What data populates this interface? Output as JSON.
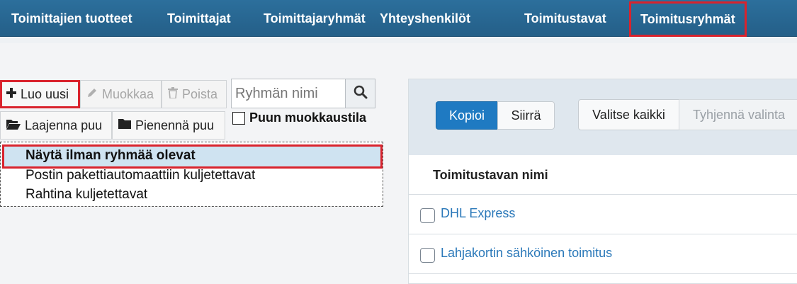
{
  "nav": {
    "tabs": [
      {
        "label": "Toimittajien tuotteet"
      },
      {
        "label": "Toimittajat"
      },
      {
        "label": "Toimittajaryhmät"
      },
      {
        "label": "Yhteyshenkilöt"
      },
      {
        "label": "Toimitustavat"
      },
      {
        "label": "Toimitusryhmät",
        "active": true
      }
    ]
  },
  "toolbar": {
    "create_label": "Luo uusi",
    "edit_label": "Muokkaa",
    "delete_label": "Poista",
    "search_placeholder": "Ryhmän nimi",
    "expand_label": "Laajenna puu",
    "collapse_label": "Pienennä puu",
    "edit_mode_label": "Puun muokkaustila"
  },
  "tree": {
    "items": [
      {
        "label": "Näytä ilman ryhmää olevat",
        "selected": true
      },
      {
        "label": "Postin pakettiautomaattiin kuljetettavat"
      },
      {
        "label": "Rahtina kuljetettavat"
      }
    ]
  },
  "panel": {
    "copy_label": "Kopioi",
    "move_label": "Siirrä",
    "select_all_label": "Valitse kaikki",
    "clear_selection_label": "Tyhjennä valinta",
    "column_header": "Toimitustavan nimi",
    "rows": [
      {
        "label": "DHL Express"
      },
      {
        "label": "Lahjakortin sähköinen toimitus"
      }
    ]
  },
  "colors": {
    "nav_bg": "#2a6a96",
    "highlight": "#d9232d",
    "link": "#2a78b9",
    "primary": "#1f7ac2"
  }
}
